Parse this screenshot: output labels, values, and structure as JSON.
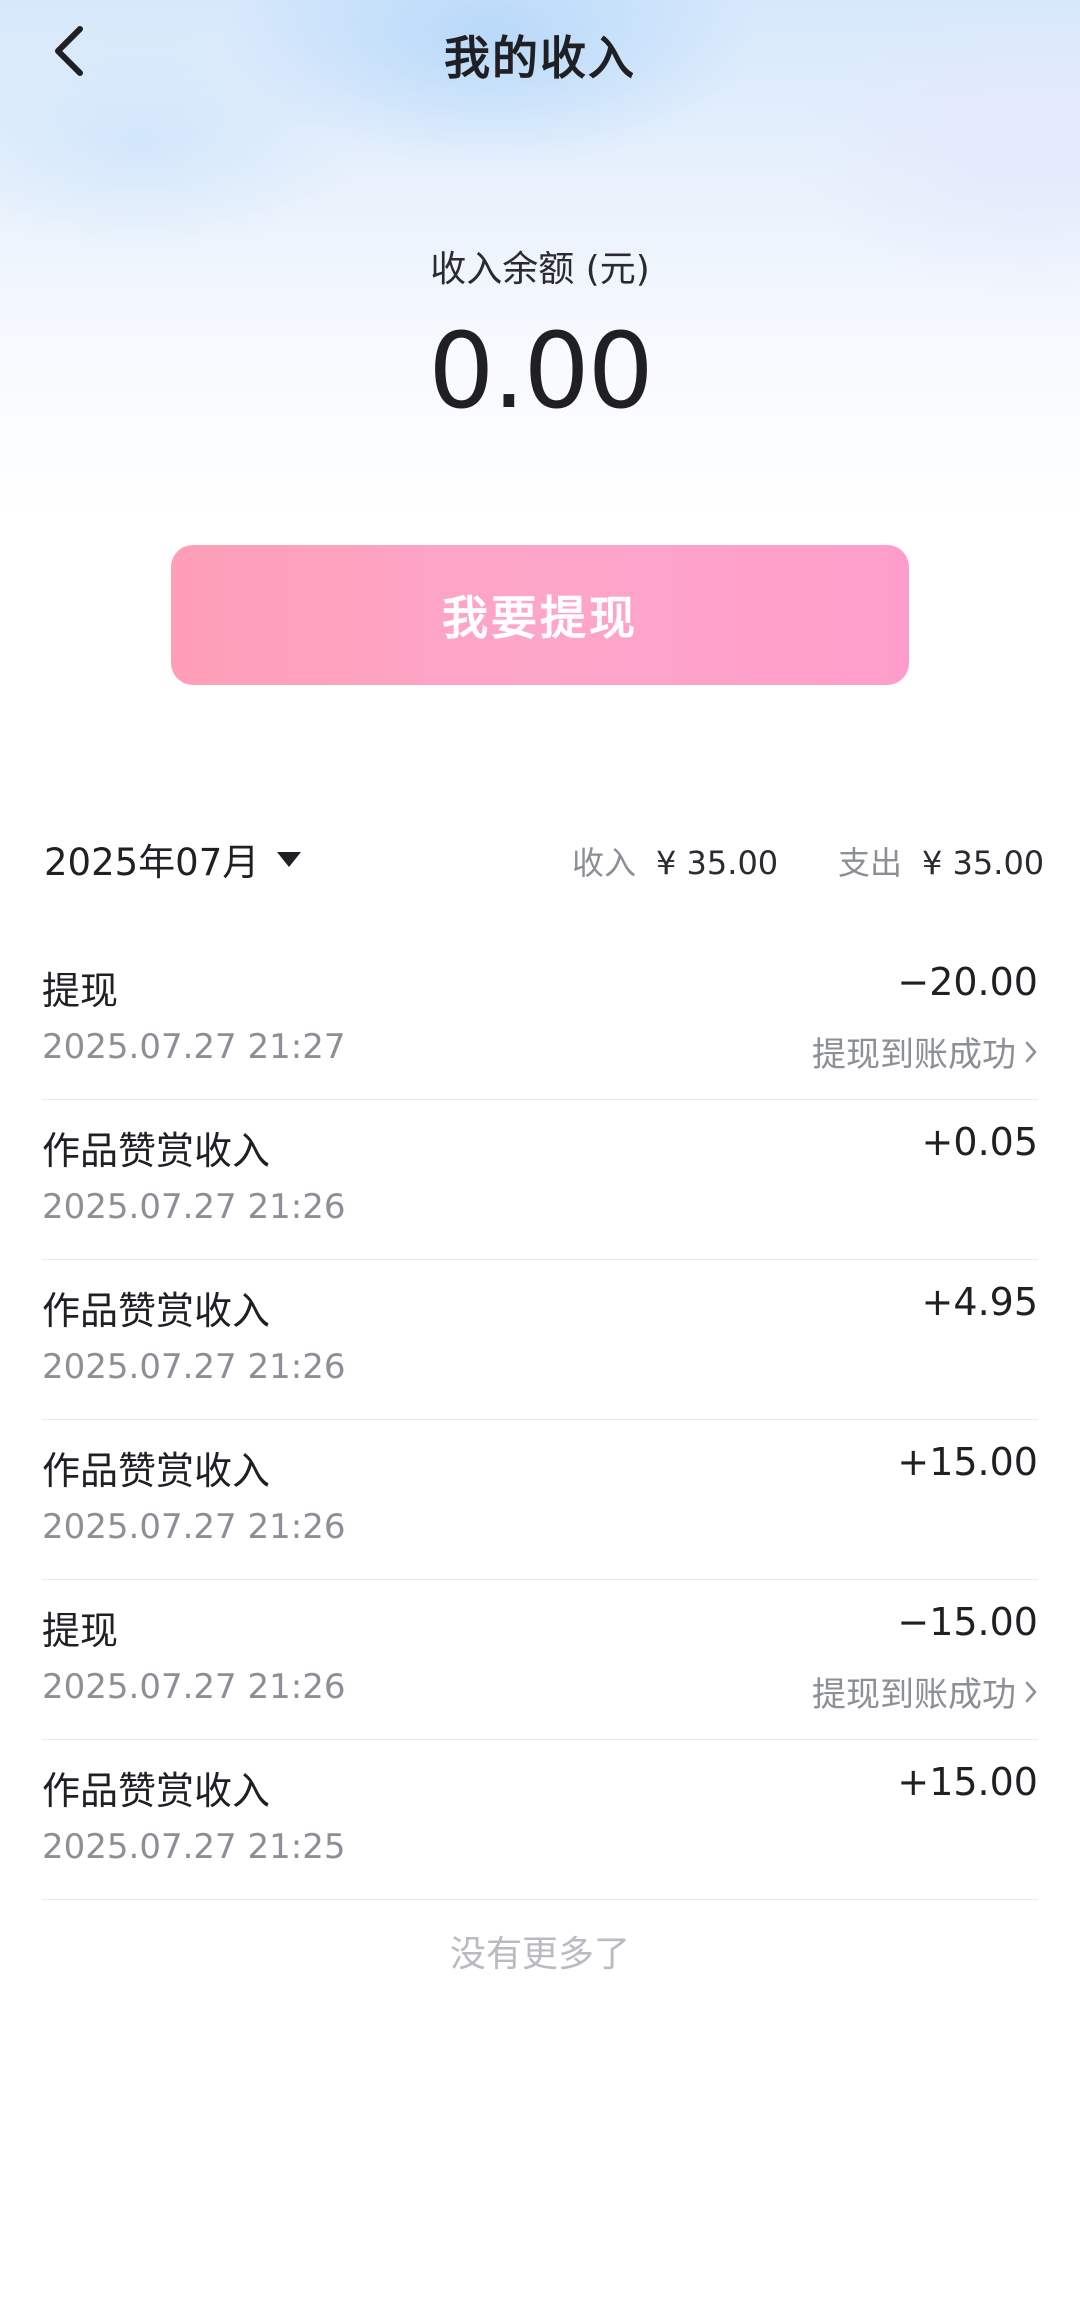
{
  "header": {
    "title": "我的收入",
    "back_icon": "chevron-left-icon"
  },
  "balance": {
    "label": "收入余额 (元)",
    "amount": "0.00"
  },
  "withdraw_button": {
    "label": "我要提现",
    "colors": [
      "#fe9eb8",
      "#fe9dcb"
    ]
  },
  "summary": {
    "month": "2025年07月",
    "income_label": "收入",
    "income_value": "¥ 35.00",
    "expense_label": "支出",
    "expense_value": "¥ 35.00"
  },
  "transactions": [
    {
      "title": "提现",
      "time": "2025.07.27 21:27",
      "amount": "−20.00",
      "status": "提现到账成功"
    },
    {
      "title": "作品赞赏收入",
      "time": "2025.07.27 21:26",
      "amount": "+0.05"
    },
    {
      "title": "作品赞赏收入",
      "time": "2025.07.27 21:26",
      "amount": "+4.95"
    },
    {
      "title": "作品赞赏收入",
      "time": "2025.07.27 21:26",
      "amount": "+15.00"
    },
    {
      "title": "提现",
      "time": "2025.07.27 21:26",
      "amount": "−15.00",
      "status": "提现到账成功"
    },
    {
      "title": "作品赞赏收入",
      "time": "2025.07.27 21:25",
      "amount": "+15.00"
    }
  ],
  "footer": {
    "no_more": "没有更多了"
  }
}
